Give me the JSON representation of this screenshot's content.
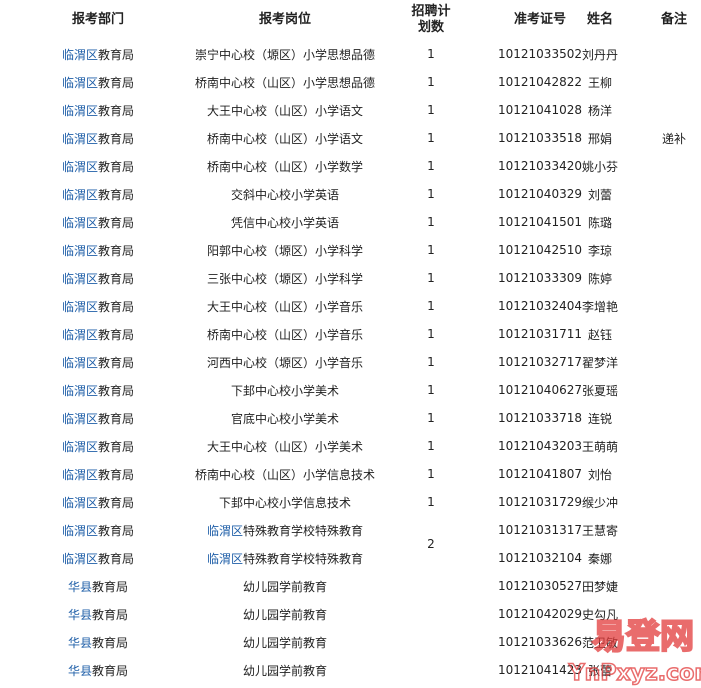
{
  "headers": {
    "dept": "报考部门",
    "post": "报考岗位",
    "quota_line1": "招聘计",
    "quota_line2": "划数",
    "exam_id": "准考证号",
    "name": "姓名",
    "note": "备注"
  },
  "rows": [
    {
      "dept_link": "临渭区",
      "dept_rest": "教育局",
      "post_link": "",
      "post": "崇宁中心校（塬区）小学思想品德",
      "quota": "1",
      "exam_id": "10121033502",
      "name": "刘丹丹",
      "note": ""
    },
    {
      "dept_link": "临渭区",
      "dept_rest": "教育局",
      "post_link": "",
      "post": "桥南中心校（山区）小学思想品德",
      "quota": "1",
      "exam_id": "10121042822",
      "name": "王柳",
      "note": ""
    },
    {
      "dept_link": "临渭区",
      "dept_rest": "教育局",
      "post_link": "",
      "post": "大王中心校（山区）小学语文",
      "quota": "1",
      "exam_id": "10121041028",
      "name": "杨洋",
      "note": ""
    },
    {
      "dept_link": "临渭区",
      "dept_rest": "教育局",
      "post_link": "",
      "post": "桥南中心校（山区）小学语文",
      "quota": "1",
      "exam_id": "10121033518",
      "name": "邢娟",
      "note": "递补"
    },
    {
      "dept_link": "临渭区",
      "dept_rest": "教育局",
      "post_link": "",
      "post": "桥南中心校（山区）小学数学",
      "quota": "1",
      "exam_id": "10121033420",
      "name": "姚小芬",
      "note": ""
    },
    {
      "dept_link": "临渭区",
      "dept_rest": "教育局",
      "post_link": "",
      "post": "交斜中心校小学英语",
      "quota": "1",
      "exam_id": "10121040329",
      "name": "刘蕾",
      "note": ""
    },
    {
      "dept_link": "临渭区",
      "dept_rest": "教育局",
      "post_link": "",
      "post": "凭信中心校小学英语",
      "quota": "1",
      "exam_id": "10121041501",
      "name": "陈璐",
      "note": ""
    },
    {
      "dept_link": "临渭区",
      "dept_rest": "教育局",
      "post_link": "",
      "post": "阳郭中心校（塬区）小学科学",
      "quota": "1",
      "exam_id": "10121042510",
      "name": "李琼",
      "note": ""
    },
    {
      "dept_link": "临渭区",
      "dept_rest": "教育局",
      "post_link": "",
      "post": "三张中心校（塬区）小学科学",
      "quota": "1",
      "exam_id": "10121033309",
      "name": "陈婷",
      "note": ""
    },
    {
      "dept_link": "临渭区",
      "dept_rest": "教育局",
      "post_link": "",
      "post": "大王中心校（山区）小学音乐",
      "quota": "1",
      "exam_id": "10121032404",
      "name": "李增艳",
      "note": ""
    },
    {
      "dept_link": "临渭区",
      "dept_rest": "教育局",
      "post_link": "",
      "post": "桥南中心校（山区）小学音乐",
      "quota": "1",
      "exam_id": "10121031711",
      "name": "赵钰",
      "note": ""
    },
    {
      "dept_link": "临渭区",
      "dept_rest": "教育局",
      "post_link": "",
      "post": "河西中心校（塬区）小学音乐",
      "quota": "1",
      "exam_id": "10121032717",
      "name": "翟梦洋",
      "note": ""
    },
    {
      "dept_link": "临渭区",
      "dept_rest": "教育局",
      "post_link": "",
      "post": "下邽中心校小学美术",
      "quota": "1",
      "exam_id": "10121040627",
      "name": "张夏瑶",
      "note": ""
    },
    {
      "dept_link": "临渭区",
      "dept_rest": "教育局",
      "post_link": "",
      "post": "官底中心校小学美术",
      "quota": "1",
      "exam_id": "10121033718",
      "name": "连锐",
      "note": ""
    },
    {
      "dept_link": "临渭区",
      "dept_rest": "教育局",
      "post_link": "",
      "post": "大王中心校（山区）小学美术",
      "quota": "1",
      "exam_id": "10121043203",
      "name": "王萌萌",
      "note": ""
    },
    {
      "dept_link": "临渭区",
      "dept_rest": "教育局",
      "post_link": "",
      "post": "桥南中心校（山区）小学信息技术",
      "quota": "1",
      "exam_id": "10121041807",
      "name": "刘怡",
      "note": ""
    },
    {
      "dept_link": "临渭区",
      "dept_rest": "教育局",
      "post_link": "",
      "post": "下邽中心校小学信息技术",
      "quota": "1",
      "exam_id": "10121031729",
      "name": "缑少冲",
      "note": ""
    },
    {
      "dept_link": "临渭区",
      "dept_rest": "教育局",
      "post_link": "临渭区",
      "post": "特殊教育学校特殊教育",
      "quota": "",
      "exam_id": "10121031317",
      "name": "王慧寄",
      "note": ""
    },
    {
      "dept_link": "临渭区",
      "dept_rest": "教育局",
      "post_link": "临渭区",
      "post": "特殊教育学校特殊教育",
      "quota": "",
      "exam_id": "10121032104",
      "name": "秦娜",
      "note": ""
    },
    {
      "dept_link": "华县",
      "dept_rest": "教育局",
      "post_link": "",
      "post": "幼儿园学前教育",
      "quota": "",
      "exam_id": "10121030527",
      "name": "田梦婕",
      "note": ""
    },
    {
      "dept_link": "华县",
      "dept_rest": "教育局",
      "post_link": "",
      "post": "幼儿园学前教育",
      "quota": "",
      "exam_id": "10121042029",
      "name": "史勾凡",
      "note": ""
    },
    {
      "dept_link": "华县",
      "dept_rest": "教育局",
      "post_link": "",
      "post": "幼儿园学前教育",
      "quota": "",
      "exam_id": "10121033626",
      "name": "范卫敏",
      "note": ""
    },
    {
      "dept_link": "华县",
      "dept_rest": "教育局",
      "post_link": "",
      "post": "幼儿园学前教育",
      "quota": "",
      "exam_id": "10121041423",
      "name": "张蕾",
      "note": ""
    }
  ],
  "merged_quota": "2",
  "watermark": {
    "text_top": "易登网",
    "text_bottom": "YnPxyz.com",
    "color": "#e23b3b"
  },
  "colors": {
    "link": "#1f5fa8",
    "text": "#222222"
  }
}
